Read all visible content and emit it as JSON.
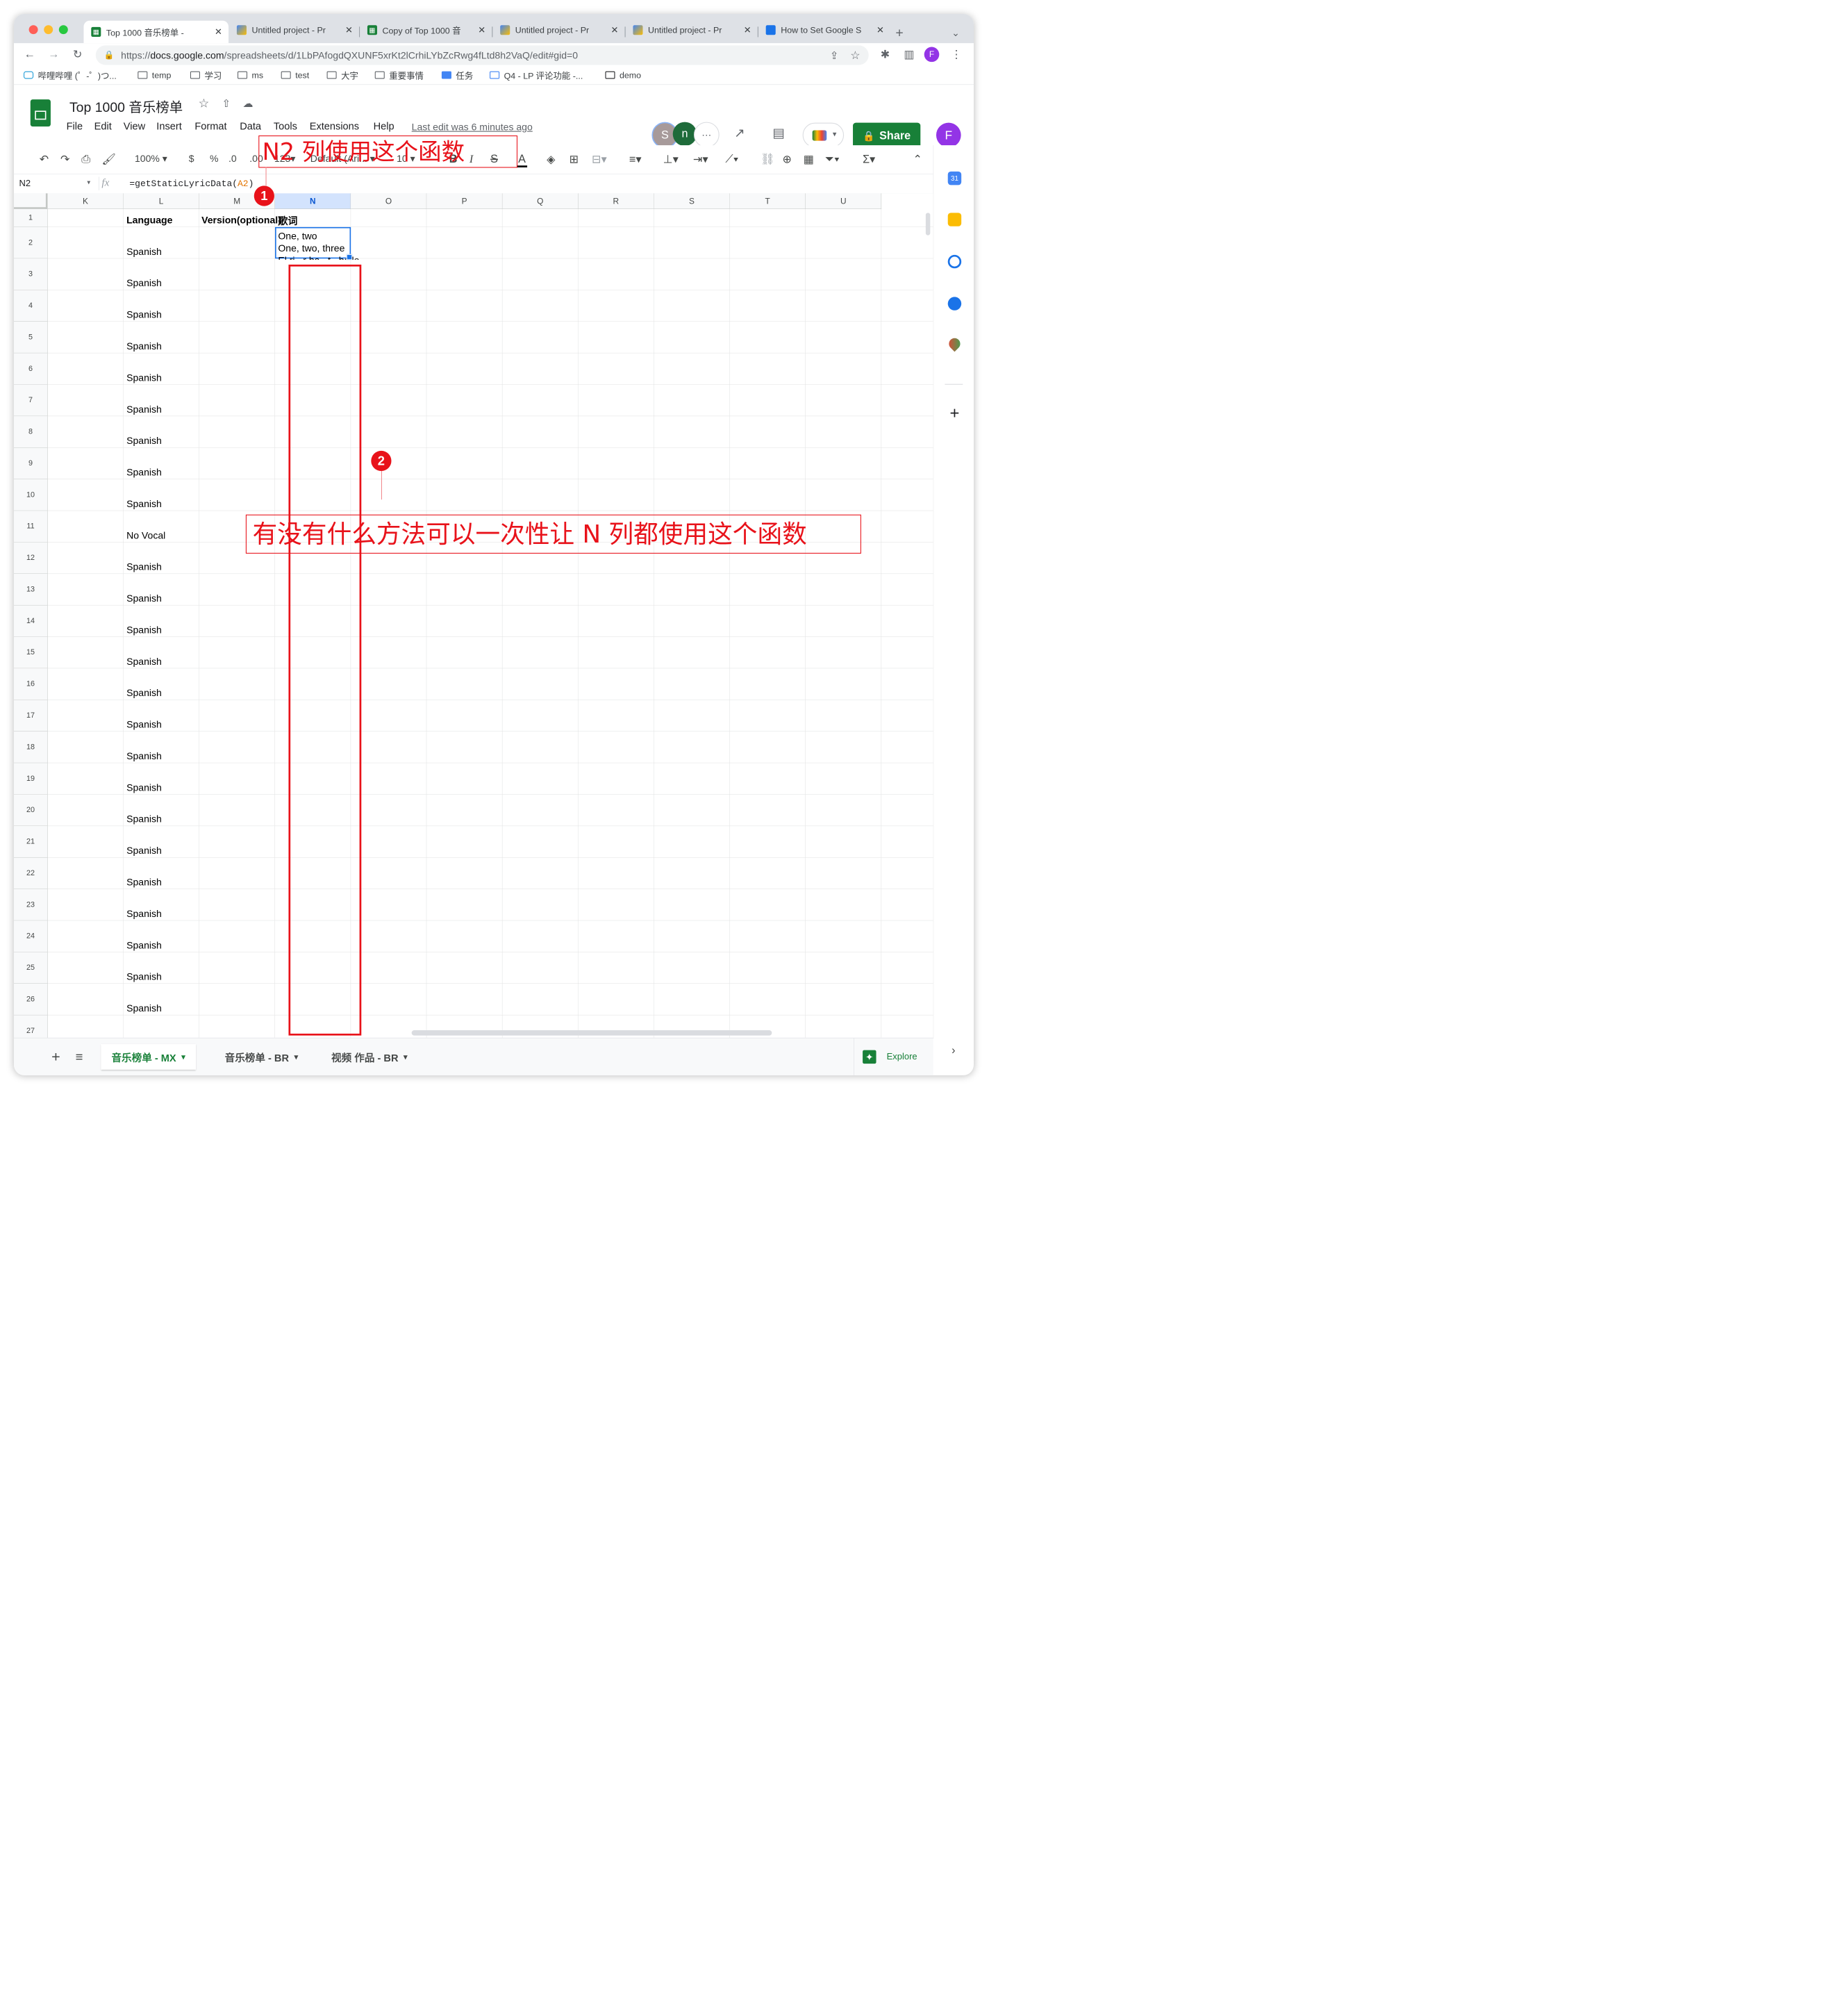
{
  "browser": {
    "tabs": [
      {
        "label": "Top 1000 音乐榜单 -",
        "icon": "sheets-icon",
        "active": true
      },
      {
        "label": "Untitled project - Pr",
        "icon": "appsscript-icon"
      },
      {
        "label": "Copy of Top 1000 音",
        "icon": "sheets-icon"
      },
      {
        "label": "Untitled project - Pr",
        "icon": "appsscript-icon"
      },
      {
        "label": "Untitled project - Pr",
        "icon": "appsscript-icon"
      },
      {
        "label": "How to Set Google S",
        "icon": "blog-icon"
      }
    ],
    "url_prefix": "https://",
    "url_host": "docs.google.com",
    "url_path": "/spreadsheets/d/1LbPAfogdQXUNF5xrKt2lCrhiLYbZcRwg4fLtd8h2VaQ/edit#gid=0",
    "profile_initial": "F",
    "bookmarks": [
      {
        "label": "哔哩哔哩 (゜-゜)つ...",
        "icon": "bilibili-icon"
      },
      {
        "label": "temp",
        "icon": "folder-icon"
      },
      {
        "label": "学习",
        "icon": "folder-icon"
      },
      {
        "label": "ms",
        "icon": "folder-icon"
      },
      {
        "label": "test",
        "icon": "folder-icon"
      },
      {
        "label": "大宇",
        "icon": "folder-icon"
      },
      {
        "label": "重要事情",
        "icon": "folder-icon"
      },
      {
        "label": "任务",
        "icon": "task-icon"
      },
      {
        "label": "Q4 - LP 评论功能 -...",
        "icon": "doc-icon"
      },
      {
        "label": "demo",
        "icon": "page-icon"
      }
    ]
  },
  "sheet": {
    "title": "Top 1000 音乐榜单",
    "menus": [
      "File",
      "Edit",
      "View",
      "Insert",
      "Format",
      "Data",
      "Tools",
      "Extensions",
      "Help"
    ],
    "last_edit": "Last edit was 6 minutes ago",
    "share_label": "Share",
    "avatars": [
      "S",
      "n"
    ],
    "user_initial": "F",
    "toolbar": {
      "zoom": "100%",
      "currency": "$",
      "percent": "%",
      "dec_less": ".0",
      "dec_more": ".00",
      "number_format": "123",
      "font": "Default (Ari...",
      "font_size": "10",
      "bold": "B",
      "italic": "I",
      "strike": "S",
      "text_color": "A"
    },
    "name_box": "N2",
    "fx": "fx",
    "formula_prefix": "=getStaticLyricData(",
    "formula_ref": "A2",
    "formula_suffix": ")",
    "columns": [
      "K",
      "L",
      "M",
      "N",
      "O",
      "P",
      "Q",
      "R",
      "S",
      "T",
      "U"
    ],
    "selected_column": "N",
    "headers": {
      "L": "Language",
      "M": "Version(optional)",
      "N": "歌词"
    },
    "n2_lines": [
      "One, two",
      "One, two, three",
      "El ri...r ba...t...ballo"
    ],
    "rows": [
      {
        "num": "1",
        "L": "Language"
      },
      {
        "num": "2",
        "L": "Spanish"
      },
      {
        "num": "3",
        "L": "Spanish"
      },
      {
        "num": "4",
        "L": "Spanish"
      },
      {
        "num": "5",
        "L": "Spanish"
      },
      {
        "num": "6",
        "L": "Spanish"
      },
      {
        "num": "7",
        "L": "Spanish"
      },
      {
        "num": "8",
        "L": "Spanish"
      },
      {
        "num": "9",
        "L": "Spanish"
      },
      {
        "num": "10",
        "L": "Spanish"
      },
      {
        "num": "11",
        "L": "No Vocal"
      },
      {
        "num": "12",
        "L": "Spanish"
      },
      {
        "num": "13",
        "L": "Spanish"
      },
      {
        "num": "14",
        "L": "Spanish"
      },
      {
        "num": "15",
        "L": "Spanish"
      },
      {
        "num": "16",
        "L": "Spanish"
      },
      {
        "num": "17",
        "L": "Spanish"
      },
      {
        "num": "18",
        "L": "Spanish"
      },
      {
        "num": "19",
        "L": "Spanish"
      },
      {
        "num": "20",
        "L": "Spanish"
      },
      {
        "num": "21",
        "L": "Spanish"
      },
      {
        "num": "22",
        "L": "Spanish"
      },
      {
        "num": "23",
        "L": "Spanish"
      },
      {
        "num": "24",
        "L": "Spanish"
      },
      {
        "num": "25",
        "L": "Spanish"
      },
      {
        "num": "26",
        "L": "Spanish"
      },
      {
        "num": "27",
        "L": ""
      }
    ],
    "sheet_tabs": [
      "音乐榜单 - MX",
      "音乐榜单 - BR",
      "视频 作品 - BR"
    ],
    "active_sheet": "音乐榜单 - MX",
    "explore_label": "Explore"
  },
  "annotations": {
    "note1": "N2 列使用这个函数",
    "badge1": "1",
    "note2": "有没有什么方法可以一次性让 N 列都使用这个函数",
    "badge2": "2",
    "color": "#e8121a"
  },
  "colors": {
    "sheets_green": "#188038",
    "selection_blue": "#1a73e8",
    "annotation_red": "#e8121a"
  }
}
